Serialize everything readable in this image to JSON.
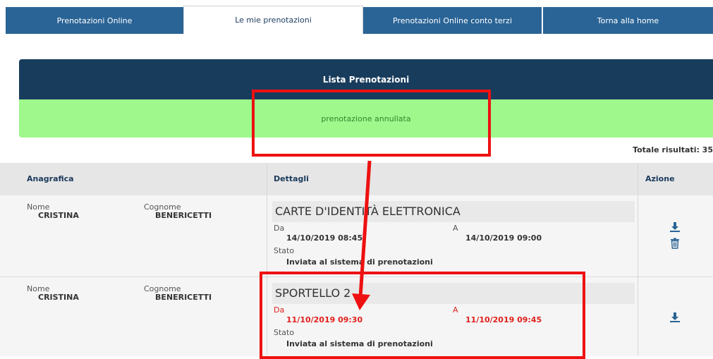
{
  "tabs": [
    "Prenotazioni Online",
    "Le mie prenotazioni",
    "Prenotazioni Online conto terzi",
    "Torna alla home"
  ],
  "panel": {
    "title": "Lista Prenotazioni",
    "alert": "prenotazione annullata"
  },
  "total": "Totale risultati: 35",
  "headers": {
    "anagrafica": "Anagrafica",
    "dettagli": "Dettagli",
    "azione": "Azione"
  },
  "labels": {
    "nome": "Nome",
    "cognome": "Cognome",
    "da": "Da",
    "a": "A",
    "stato": "Stato"
  },
  "rows": [
    {
      "nome": "CRISTINA",
      "cognome": "BENERICETTI",
      "service": "CARTE D'IDENTITÀ ELETTRONICA",
      "da": "14/10/2019 08:45",
      "a": "14/10/2019 09:00",
      "stato": "Inviata al sistema di prenotazioni"
    },
    {
      "nome": "CRISTINA",
      "cognome": "BENERICETTI",
      "service": "SPORTELLO 2",
      "da": "11/10/2019 09:30",
      "a": "11/10/2019 09:45",
      "stato": "Inviata al sistema di prenotazioni"
    }
  ],
  "colors": {
    "tab": "#2a6496",
    "header": "#183c5c",
    "alert_bg": "#9ef88c",
    "annotation": "#ee1111",
    "highlight_text": "#e0201c"
  },
  "icons": {
    "download": "download-icon",
    "delete": "trash-icon"
  }
}
